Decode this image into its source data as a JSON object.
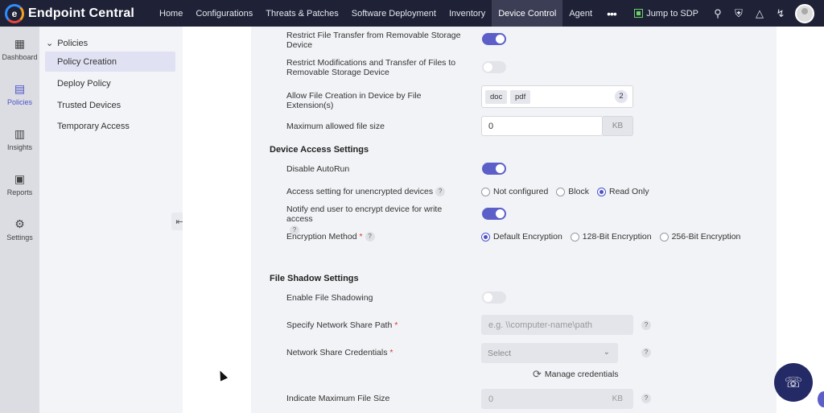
{
  "app": {
    "title": "Endpoint Central",
    "logo_letter": "e"
  },
  "nav": [
    {
      "label": "Home"
    },
    {
      "label": "Configurations"
    },
    {
      "label": "Threats & Patches"
    },
    {
      "label": "Software Deployment"
    },
    {
      "label": "Inventory"
    },
    {
      "label": "Device Control",
      "active": true
    },
    {
      "label": "Agent"
    }
  ],
  "nav_more": "•••",
  "topbar": {
    "jump_label": "Jump to SDP"
  },
  "rail": [
    {
      "label": "Dashboard",
      "icon": "dashboard-icon",
      "glyph": "▦"
    },
    {
      "label": "Policies",
      "icon": "policies-icon",
      "glyph": "▤",
      "active": true
    },
    {
      "label": "Insights",
      "icon": "insights-icon",
      "glyph": "▥"
    },
    {
      "label": "Reports",
      "icon": "reports-icon",
      "glyph": "▣"
    },
    {
      "label": "Settings",
      "icon": "settings-icon",
      "glyph": "⚙"
    }
  ],
  "sidebar": {
    "header": "Policies",
    "items": [
      {
        "label": "Policy Creation",
        "active": true
      },
      {
        "label": "Deploy Policy"
      },
      {
        "label": "Trusted Devices"
      },
      {
        "label": "Temporary Access"
      }
    ]
  },
  "form": {
    "restrict_transfer": {
      "label": "Restrict File Transfer from Removable Storage Device",
      "on": true
    },
    "restrict_modifications": {
      "label": "Restrict Modifications and Transfer of Files to Removable Storage Device",
      "on": false
    },
    "allow_extension": {
      "label": "Allow File Creation in Device by File Extension(s)",
      "tags": [
        "doc",
        "pdf"
      ],
      "count": "2"
    },
    "max_file_size": {
      "label": "Maximum allowed file size",
      "value": "0",
      "unit": "KB"
    },
    "device_access_section": "Device Access Settings",
    "disable_autorun": {
      "label": "Disable AutoRun",
      "on": true
    },
    "unencrypted_access": {
      "label": "Access setting for unencrypted devices",
      "options": [
        "Not configured",
        "Block",
        "Read Only"
      ],
      "selected": "Read Only"
    },
    "notify_encrypt": {
      "label": "Notify end user to encrypt device for write access",
      "on": true
    },
    "encryption_method": {
      "label": "Encryption Method",
      "required": "*",
      "options": [
        "Default Encryption",
        "128-Bit Encryption",
        "256-Bit Encryption"
      ],
      "selected": "Default Encryption"
    },
    "file_shadow_section": "File Shadow Settings",
    "enable_shadowing": {
      "label": "Enable File Shadowing",
      "on": false
    },
    "network_share_path": {
      "label": "Specify Network Share Path",
      "required": "*",
      "placeholder": "e.g. \\\\computer-name\\path"
    },
    "network_credentials": {
      "label": "Network Share Credentials",
      "required": "*",
      "placeholder": "Select"
    },
    "manage_credentials": "Manage credentials",
    "max_shadow_size": {
      "label": "Indicate Maximum File Size",
      "value": "0",
      "unit": "KB"
    }
  },
  "help_glyph": "?"
}
